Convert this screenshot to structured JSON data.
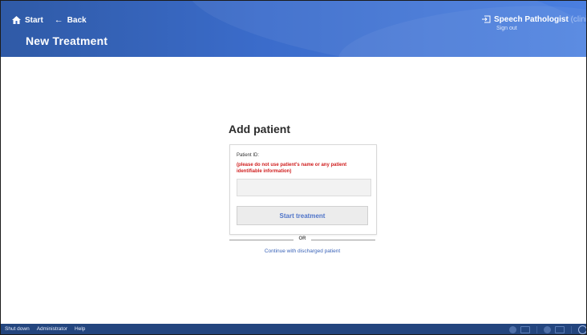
{
  "header": {
    "nav": {
      "start_label": "Start",
      "back_label": "Back",
      "back_arrow": "←"
    },
    "title": "New Treatment",
    "user": {
      "name": "Speech Pathologist",
      "role": "(clinician",
      "signout_label": "Sign out"
    }
  },
  "main": {
    "heading": "Add patient",
    "patient_id_label": "Patient ID:",
    "warning": "(please do not use patient's name or any patient identifiable information)",
    "patient_id_value": "",
    "start_button_label": "Start treatment",
    "or_label": "OR",
    "discharged_link": "Continue with discharged patient"
  },
  "footer": {
    "links": [
      "Shut down",
      "Administrator",
      "Help"
    ]
  },
  "icons": {
    "home": "home-icon",
    "sign_in": "sign-in-icon"
  },
  "colors": {
    "header_start": "#2f5aa6",
    "header_end": "#4a7fe0",
    "warning": "#d02020",
    "link": "#3a63b8",
    "footer": "#23457e"
  }
}
